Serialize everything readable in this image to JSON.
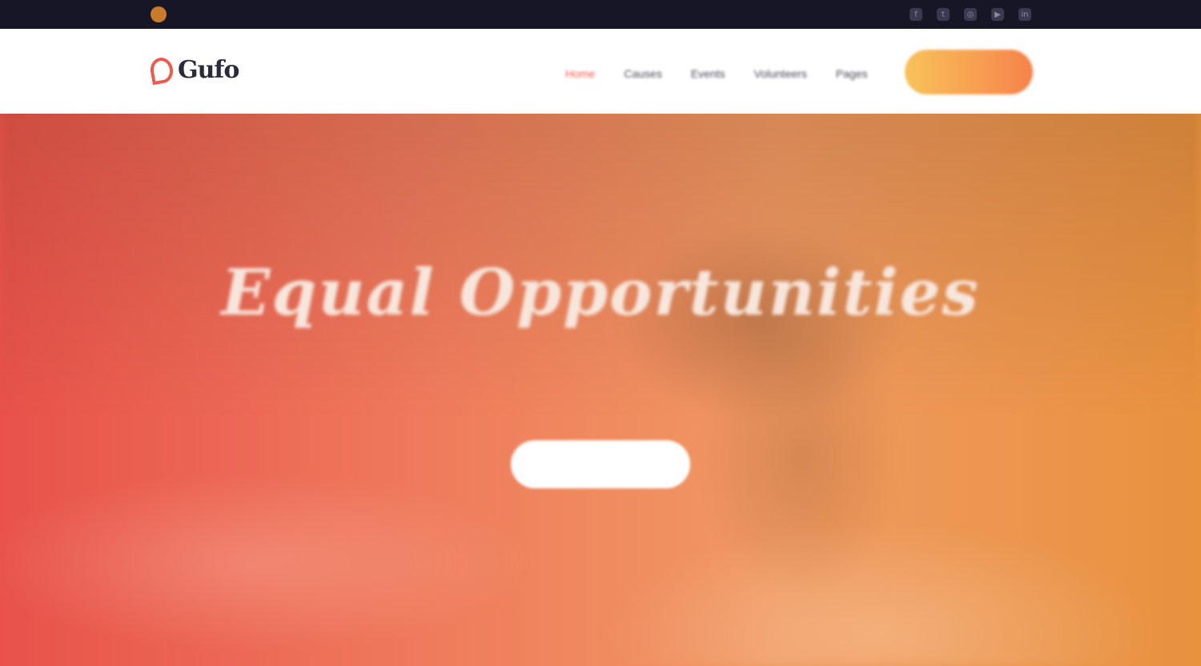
{
  "topbar": {
    "contact_text": "",
    "social_icons": [
      "facebook-icon",
      "twitter-icon",
      "instagram-icon",
      "youtube-icon",
      "linkedin-icon"
    ]
  },
  "header": {
    "logo_text": "Gufo",
    "nav": [
      {
        "label": "Home",
        "active": true
      },
      {
        "label": "Causes",
        "active": false
      },
      {
        "label": "Events",
        "active": false
      },
      {
        "label": "Volunteers",
        "active": false
      },
      {
        "label": "Pages",
        "active": false
      }
    ],
    "cta_label": ""
  },
  "hero": {
    "title": "Equal Opportunities",
    "subtitle_line1": "",
    "subtitle_line2": "",
    "button_label": ""
  },
  "colors": {
    "topbar_bg": "#171626",
    "accent": "#ef5a4a",
    "cta_gradient_start": "#f8c25a",
    "cta_gradient_end": "#f6824a",
    "hero_gradient_start": "#e8524a",
    "hero_gradient_end": "#e8923e"
  }
}
